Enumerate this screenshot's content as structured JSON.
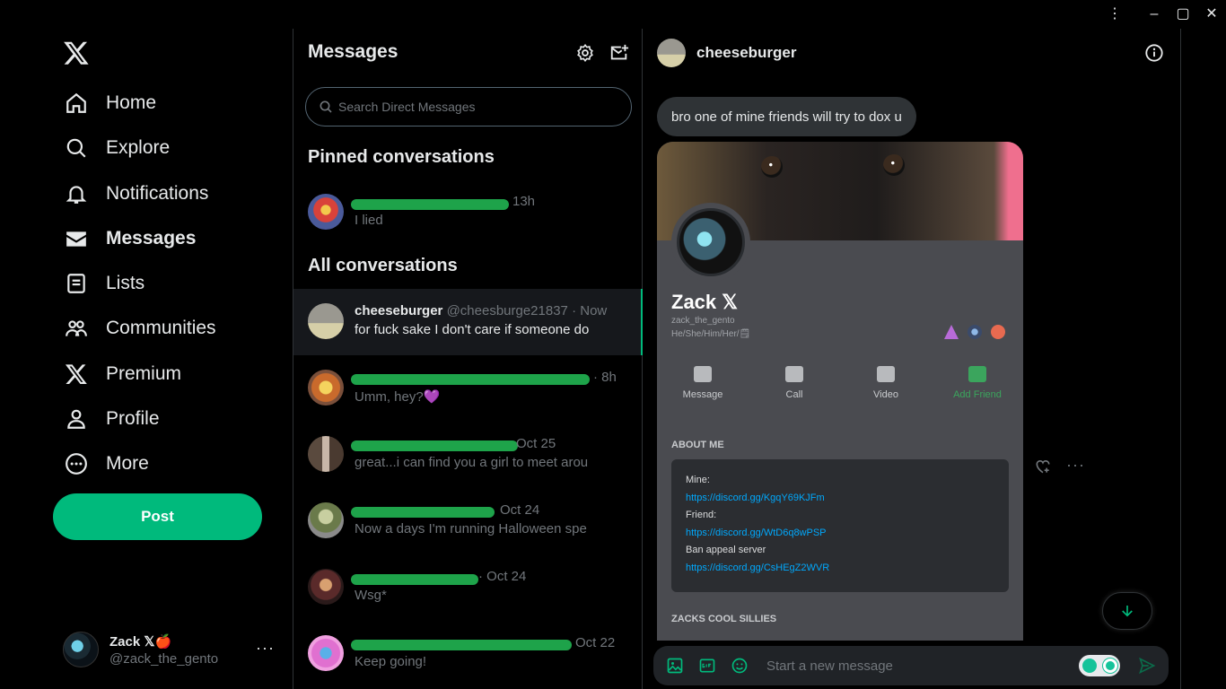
{
  "window": {
    "menu_icon": "⋮",
    "minimize_icon": "–",
    "maximize_icon": "▢",
    "close_icon": "✕"
  },
  "nav": {
    "items": [
      {
        "label": "Home",
        "icon": "home-icon"
      },
      {
        "label": "Explore",
        "icon": "search-icon"
      },
      {
        "label": "Notifications",
        "icon": "bell-icon"
      },
      {
        "label": "Messages",
        "icon": "envelope-icon",
        "active": true
      },
      {
        "label": "Lists",
        "icon": "list-icon"
      },
      {
        "label": "Communities",
        "icon": "people-icon"
      },
      {
        "label": "Premium",
        "icon": "x-logo-icon"
      },
      {
        "label": "Profile",
        "icon": "person-icon"
      },
      {
        "label": "More",
        "icon": "more-circle-icon"
      }
    ],
    "post_label": "Post",
    "account": {
      "name": "Zack 𝕏🍎",
      "handle": "@zack_the_gento",
      "more": "···"
    }
  },
  "messages": {
    "title": "Messages",
    "search_placeholder": "Search Direct Messages",
    "pinned_heading": "Pinned conversations",
    "all_heading": "All conversations",
    "pinned": [
      {
        "name": "",
        "handle": "",
        "time": "13h",
        "preview": "I lied"
      }
    ],
    "conversations": [
      {
        "name": "cheeseburger",
        "handle": "@cheesburge21837",
        "time": "· Now",
        "preview": "for fuck sake I don't care if someone do",
        "selected": true
      },
      {
        "name": "",
        "handle": "",
        "time": "· 8h",
        "preview": "Umm, hey?💜"
      },
      {
        "name": "",
        "handle": "",
        "time": "Oct 25",
        "preview": "great...i can find you a girl to meet arou"
      },
      {
        "name": "",
        "handle": "",
        "time": "Oct 24",
        "preview": "Now a days I'm running Halloween spe"
      },
      {
        "name": "",
        "handle": "",
        "time": "· Oct 24",
        "preview": "Wsg*"
      },
      {
        "name": "",
        "handle": "",
        "time": "Oct 22",
        "preview": "Keep going!"
      }
    ]
  },
  "chat": {
    "name": "cheeseburger",
    "bubble": "bro one of mine friends will try to dox u",
    "card": {
      "name": "Zack 𝕏",
      "username": "zack_the_gento",
      "pronouns": "He/She/Him/Her/🗒",
      "actions": [
        "Message",
        "Call",
        "Video",
        "Add Friend"
      ],
      "about_heading": "ABOUT ME",
      "about": [
        {
          "label": "Mine:",
          "link": "https://discord.gg/KgqY69KJFm"
        },
        {
          "label": "Friend:",
          "link": "https://discord.gg/WtD6q8wPSP"
        },
        {
          "label": "Ban appeal server",
          "link": "https://discord.gg/CsHEgZ2WVR"
        }
      ],
      "cool_heading": "ZACKS COOL SILLIES"
    },
    "composer_placeholder": "Start a new message"
  },
  "colors": {
    "accent": "#00ba7c",
    "link": "#00a8fc",
    "border": "#2f3336",
    "muted": "#71767b"
  }
}
